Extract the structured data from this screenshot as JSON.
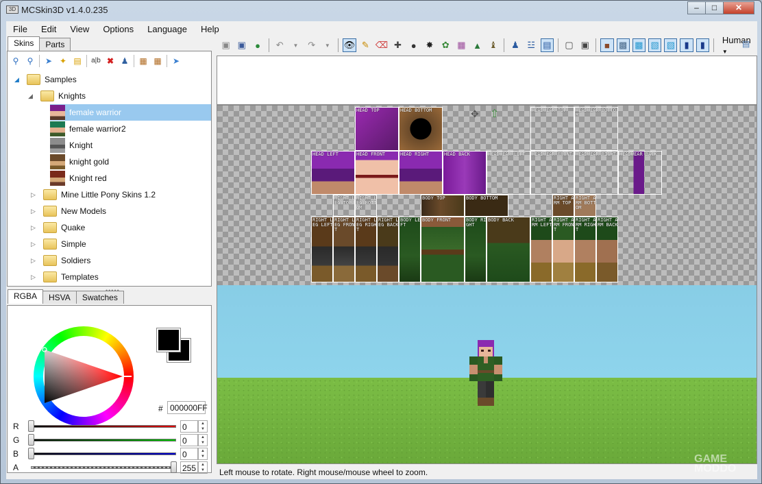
{
  "window": {
    "title": "MCSkin3D v1.4.0.235",
    "icon": "3D"
  },
  "menu": [
    "File",
    "Edit",
    "View",
    "Options",
    "Language",
    "Help"
  ],
  "left_tabs": [
    "Skins",
    "Parts"
  ],
  "tree": {
    "root": "Samples",
    "knights_folder": "Knights",
    "skins": [
      "female warrior",
      "female warrior2",
      "Knight",
      "knight gold",
      "Knight red"
    ],
    "folders": [
      "Mine Little Pony Skins 1.2",
      "New Models",
      "Quake",
      "Simple",
      "Soldiers",
      "Templates"
    ],
    "selected": "female warrior"
  },
  "color_tabs": [
    "RGBA",
    "HSVA",
    "Swatches"
  ],
  "color": {
    "hex_label": "#",
    "hex": "000000FF",
    "channels": [
      {
        "label": "R",
        "value": "0",
        "color": "#e00000"
      },
      {
        "label": "G",
        "value": "0",
        "color": "#00c000"
      },
      {
        "label": "B",
        "value": "0",
        "color": "#0000d0"
      },
      {
        "label": "A",
        "value": "255",
        "color": "#444444"
      }
    ]
  },
  "toolbar": {
    "model": "Human"
  },
  "texture_labels": {
    "head_top": "HEAD TOP",
    "head_bottom": "HEAD BOTTOM",
    "headwear_top": "HEADWEAR TOP",
    "headwear_bottom": "HEADWEAR BOTTOM",
    "head_left": "HEAD LEFT",
    "head_front": "HEAD FRONT",
    "head_right": "HEAD RIGHT",
    "head_back": "HEAD BACK",
    "headwear_left": "HEADWEAR LEFT",
    "headwear_front": "HEADWEAR FRONT",
    "headwear_right": "HEADWEAR RIGHT",
    "headwear_back": "HEADWEAR BACK",
    "leg_top": "RIGHT LEG TOP",
    "leg_bottom": "RIGHT LEG BOTTOM",
    "body_top": "BODY TOP",
    "body_bottom": "BODY BOTTOM",
    "arm_top": "RIGHT ARM TOP",
    "arm_bottom": "RIGHT ARM BOTTOM",
    "leg_left": "RIGHT LEG LEFT",
    "leg_front": "RIGHT LEG FRONT",
    "leg_right": "RIGHT LEG RIGHT",
    "leg_back": "RIGHT LEG BACK",
    "body_left": "BODY LEFT",
    "body_front": "BODY FRONT",
    "body_right": "BODY RIGHT",
    "body_back": "BODY BACK",
    "arm_left": "RIGHT ARM LEFT",
    "arm_front": "RIGHT ARM FRONT",
    "arm_right": "RIGHT ARM RIGHT",
    "arm_back": "RIGHT ARM BACK"
  },
  "status": "Left mouse to rotate. Right mouse/mouse wheel to zoom.",
  "watermark": "GAME MODDO"
}
